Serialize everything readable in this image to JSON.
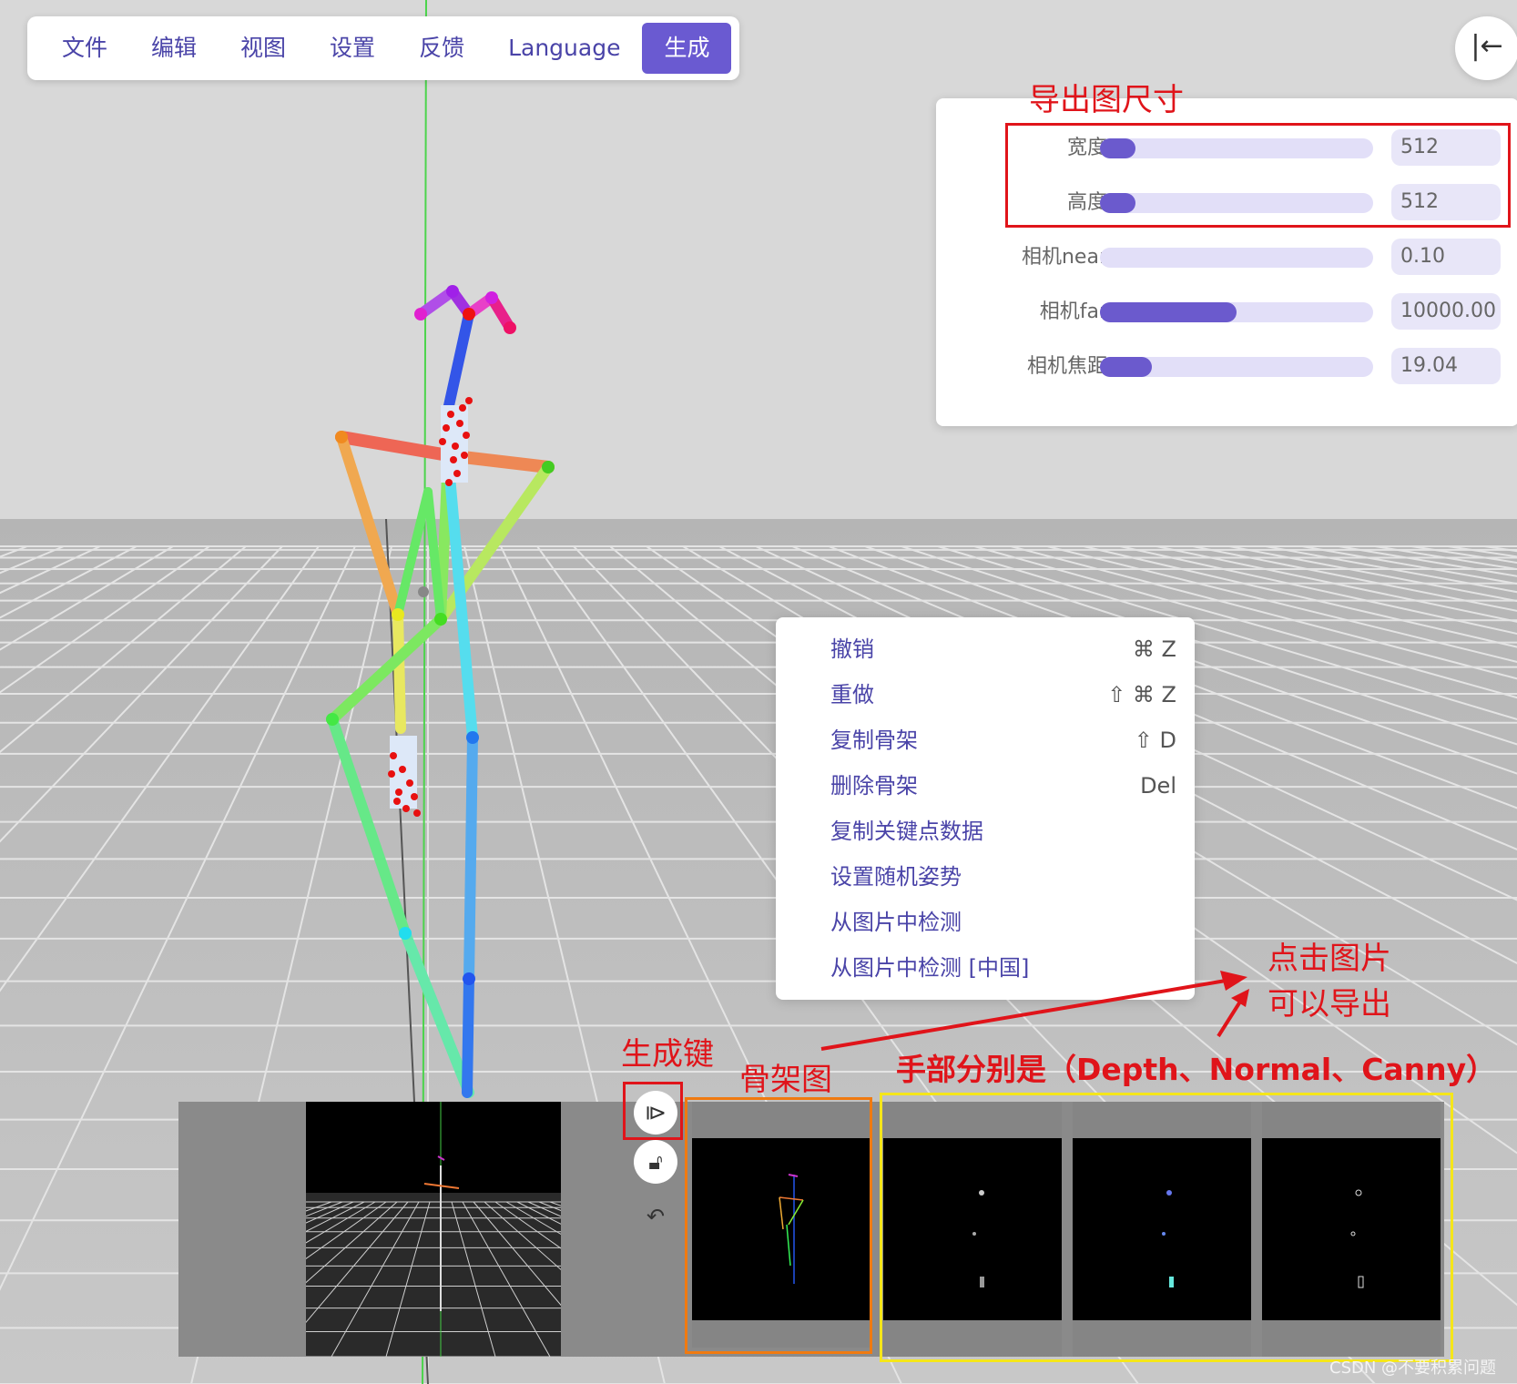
{
  "menu": {
    "items": [
      "文件",
      "编辑",
      "视图",
      "设置",
      "反馈",
      "Language",
      "生成"
    ],
    "active_index": 6
  },
  "collapse_button": {
    "glyph": "|←"
  },
  "export_panel": {
    "rows": [
      {
        "label": "宽度",
        "value": "512",
        "level": 0.13
      },
      {
        "label": "高度",
        "value": "512",
        "level": 0.13
      },
      {
        "label": "相机near",
        "value": "0.10",
        "level": 0.0
      },
      {
        "label": "相机far",
        "value": "10000.00",
        "level": 0.5
      },
      {
        "label": "相机焦距",
        "value": "19.04",
        "level": 0.19
      }
    ]
  },
  "context_menu": {
    "items": [
      {
        "label": "撤销",
        "shortcut": "⌘ Z"
      },
      {
        "label": "重做",
        "shortcut": "⇧ ⌘ Z"
      },
      {
        "label": "复制骨架",
        "shortcut": "⇧ D"
      },
      {
        "label": "删除骨架",
        "shortcut": "Del"
      },
      {
        "label": "复制关键点数据",
        "shortcut": ""
      },
      {
        "label": "设置随机姿势",
        "shortcut": ""
      },
      {
        "label": "从图片中检测",
        "shortcut": ""
      },
      {
        "label": "从图片中检测 [中国]",
        "shortcut": ""
      }
    ]
  },
  "annotations": {
    "export_size": "导出图尺寸",
    "generate_key": "生成键",
    "skeleton_map": "骨架图",
    "hands_maps": "手部分别是（Depth、Normal、Canny）",
    "click_line1": "点击图片",
    "click_line2": "可以导出"
  },
  "colors": {
    "accent": "#6b5acd",
    "menu_text": "#4a44a8",
    "annotation": "#e0141a",
    "highlight_red": "#e0141a",
    "highlight_orange": "#f07a10",
    "highlight_yellow": "#f5e61a"
  },
  "icons": {
    "generate": "play-step-icon",
    "lock": "unlock-icon",
    "undo": "undo-icon"
  },
  "watermark": "CSDN @不要积累问题"
}
